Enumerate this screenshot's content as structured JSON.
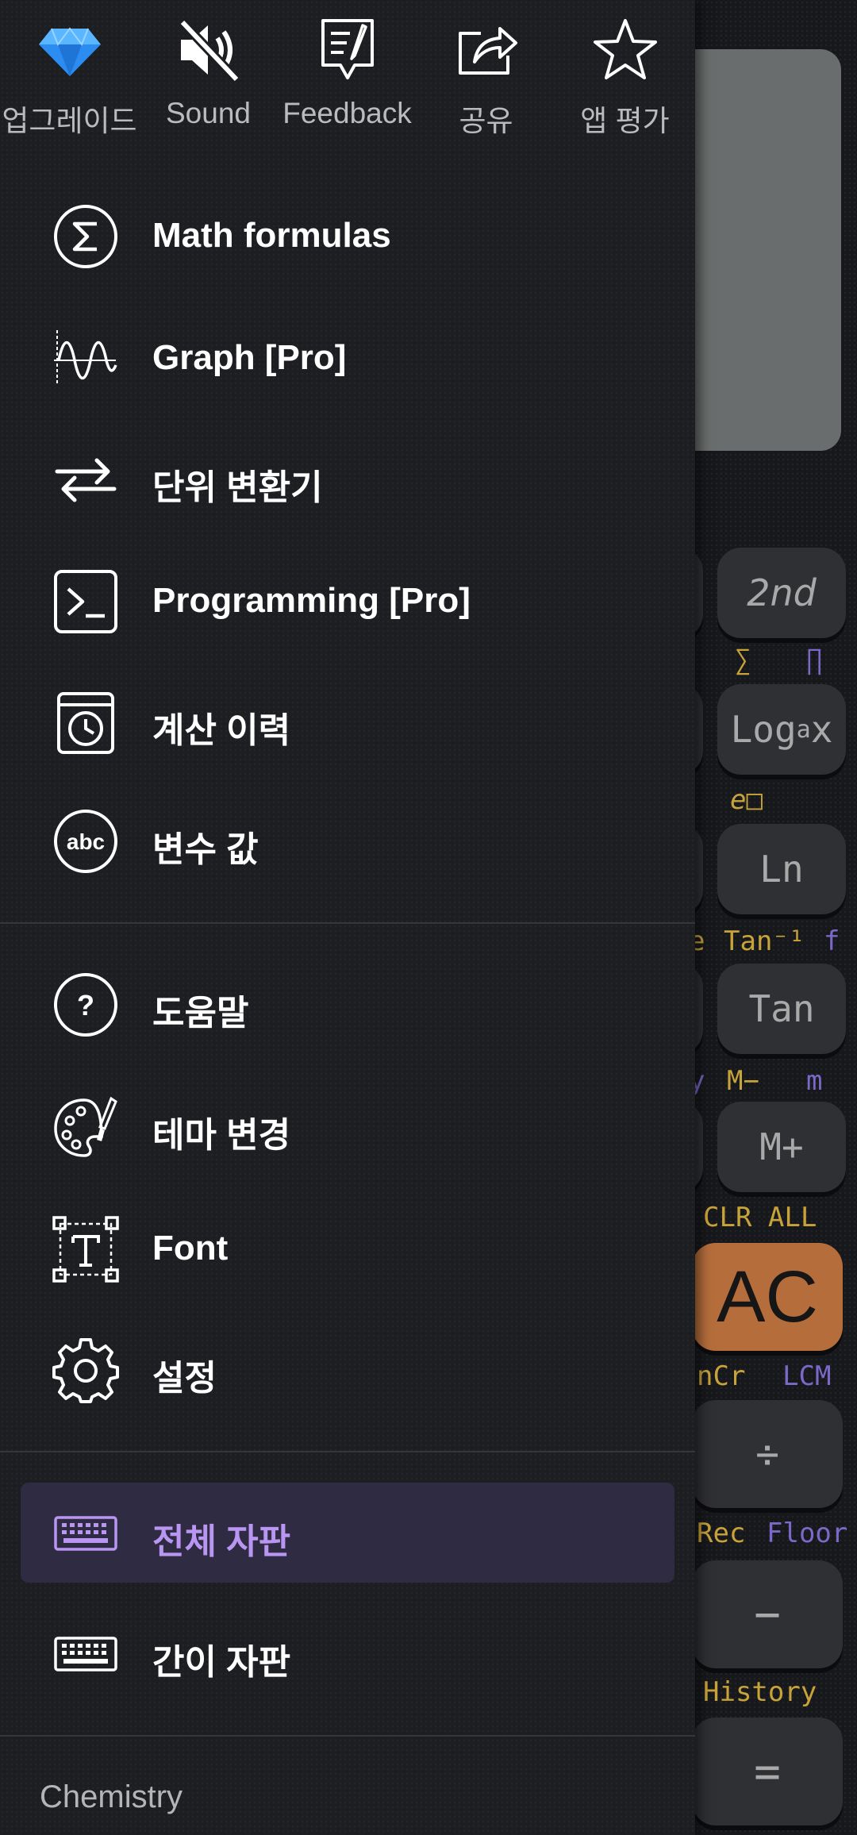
{
  "top_actions": [
    {
      "label": "업그레이드",
      "icon": "diamond-icon"
    },
    {
      "label": "Sound",
      "icon": "sound-off-icon"
    },
    {
      "label": "Feedback",
      "icon": "feedback-icon"
    },
    {
      "label": "공유",
      "icon": "share-icon"
    },
    {
      "label": "앱 평가",
      "icon": "star-icon"
    }
  ],
  "menu": {
    "tools": [
      {
        "label": "Math formulas",
        "icon": "sigma-icon"
      },
      {
        "label": "Graph [Pro]",
        "icon": "graph-icon"
      },
      {
        "label": "단위 변환기",
        "icon": "convert-arrows-icon"
      },
      {
        "label": "Programming [Pro]",
        "icon": "terminal-icon"
      },
      {
        "label": "계산 이력",
        "icon": "history-icon"
      },
      {
        "label": "변수 값",
        "icon": "abc-icon"
      }
    ],
    "settings": [
      {
        "label": "도움말",
        "icon": "help-icon"
      },
      {
        "label": "테마 변경",
        "icon": "palette-icon"
      },
      {
        "label": "Font",
        "icon": "font-icon"
      },
      {
        "label": "설정",
        "icon": "gear-icon"
      }
    ],
    "keyboards": [
      {
        "label": "전체 자판",
        "icon": "keyboard-icon",
        "selected": true
      },
      {
        "label": "간이 자판",
        "icon": "keyboard-icon",
        "selected": false
      }
    ],
    "section_header": "Chemistry"
  },
  "calculator": {
    "keys": {
      "second": "2nd",
      "loga_main": "Log",
      "loga_sub": "a",
      "loga_x": "x",
      "ln": "Ln",
      "tan": "Tan",
      "mplus": "M+",
      "ac": "AC",
      "divide": "÷",
      "minus": "−",
      "equals": "="
    },
    "labels": {
      "sum": "∑",
      "product": "∏",
      "e_power": "e□",
      "tan_inverse": "Tan⁻¹",
      "f": "f",
      "mminus": "M−",
      "m": "m",
      "clr_all": "CLR ALL",
      "ncr": "nCr",
      "lcm": "LCM",
      "rec": "Rec",
      "floor": "Floor",
      "history": "History",
      "e_partial": "e",
      "y_partial": "y"
    }
  },
  "colors": {
    "accent": "#b996f2",
    "selected_bg": "#2f2b42",
    "drawer_bg": "#1c1e22",
    "key_label_gold": "#c8a33a",
    "key_label_purple": "#7b68c9",
    "ac_key": "#b56e3b"
  }
}
